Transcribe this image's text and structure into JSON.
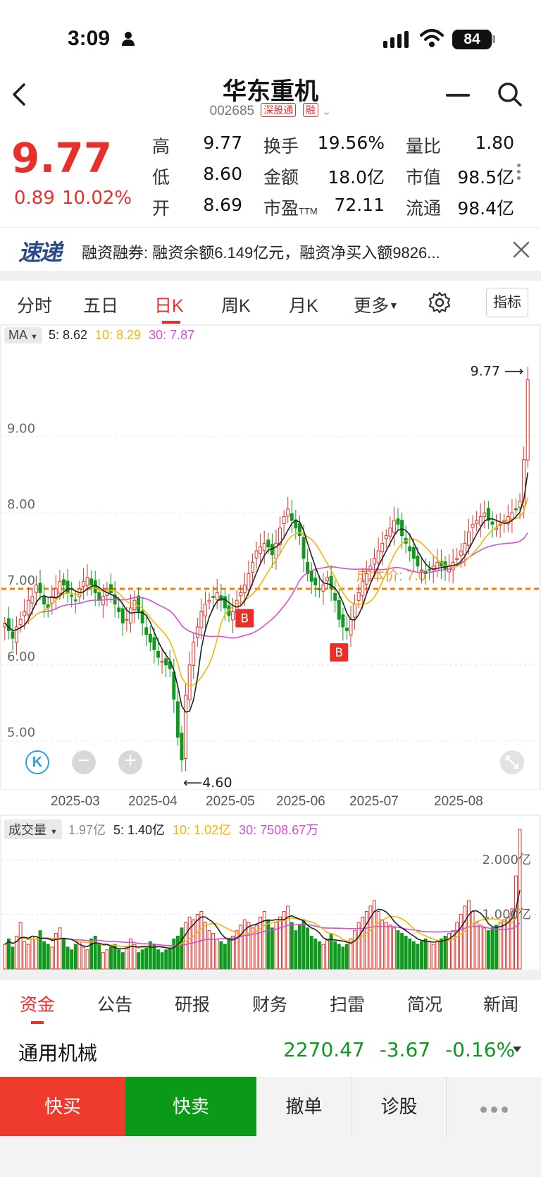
{
  "status_bar": {
    "time": "3:09",
    "battery": "84"
  },
  "header": {
    "name": "华东重机",
    "code": "002685",
    "tags": [
      "深股通",
      "融"
    ]
  },
  "quote": {
    "price": "9.77",
    "change": "0.89",
    "change_pct": "10.02%",
    "rows": [
      [
        {
          "label": "高",
          "value": "9.77",
          "color": "red"
        },
        {
          "label": "换手",
          "value": "19.56%"
        },
        {
          "label": "量比",
          "value": "1.80"
        }
      ],
      [
        {
          "label": "低",
          "value": "8.60",
          "color": "green"
        },
        {
          "label": "金额",
          "value": "18.0亿"
        },
        {
          "label": "市值",
          "value": "98.5亿"
        }
      ],
      [
        {
          "label": "开",
          "value": "8.69",
          "color": "green"
        },
        {
          "label": "市盈",
          "sub": "TTM",
          "value": "72.11"
        },
        {
          "label": "流通",
          "value": "98.4亿"
        }
      ]
    ]
  },
  "news": {
    "logo": "速递",
    "text": "融资融券: 融资余额6.149亿元，融资净买入额9826..."
  },
  "period_tabs": [
    "分时",
    "五日",
    "日K",
    "周K",
    "月K",
    "更多"
  ],
  "indicator_label": "指标",
  "ma_legend": {
    "selector": "MA",
    "ma5": "5: 8.62",
    "ma10": "10: 8.29",
    "ma30": "30: 7.87"
  },
  "chart_data": {
    "type": "candlestick",
    "x_tick_labels": [
      "2025-03",
      "2025-04",
      "2025-05",
      "2025-06",
      "2025-07",
      "2025-08"
    ],
    "y_tick_labels": [
      "9.00",
      "8.00",
      "7.00",
      "6.00",
      "5.00"
    ],
    "ylim": [
      4.45,
      10.2
    ],
    "max_label": "9.77",
    "min_label": "4.60",
    "cost_line": {
      "value": 7.0,
      "label": "成本价: 7.0",
      "color": "#ff7a00"
    },
    "buy_markers": [
      {
        "index": 61,
        "label": "B"
      },
      {
        "index": 85,
        "label": "B"
      }
    ],
    "closes": [
      6.55,
      6.45,
      6.35,
      6.5,
      6.6,
      6.7,
      6.85,
      6.9,
      7.05,
      6.95,
      6.8,
      6.75,
      6.9,
      7.0,
      7.1,
      7.05,
      6.95,
      6.9,
      6.85,
      7.0,
      7.1,
      7.15,
      7.05,
      6.95,
      6.85,
      6.9,
      7.0,
      6.95,
      6.8,
      6.7,
      6.55,
      6.6,
      6.75,
      6.85,
      6.7,
      6.55,
      6.4,
      6.3,
      6.2,
      6.1,
      6.05,
      6.0,
      5.95,
      5.55,
      5.05,
      4.75,
      5.6,
      6.0,
      6.3,
      6.5,
      6.7,
      6.8,
      6.85,
      6.9,
      6.95,
      6.85,
      6.75,
      6.65,
      6.7,
      6.85,
      6.95,
      7.05,
      7.2,
      7.35,
      7.5,
      7.55,
      7.6,
      7.55,
      7.45,
      7.6,
      7.8,
      7.95,
      8.05,
      7.9,
      7.8,
      7.7,
      7.4,
      7.2,
      7.1,
      7.05,
      7.0,
      7.05,
      7.15,
      7.0,
      6.85,
      6.6,
      6.5,
      6.45,
      6.6,
      6.8,
      6.95,
      7.1,
      7.2,
      7.3,
      7.4,
      7.5,
      7.6,
      7.7,
      7.8,
      7.9,
      7.85,
      7.7,
      7.6,
      7.5,
      7.4,
      7.3,
      7.25,
      7.2,
      7.25,
      7.3,
      7.35,
      7.3,
      7.25,
      7.3,
      7.35,
      7.4,
      7.5,
      7.6,
      7.75,
      7.85,
      7.9,
      7.95,
      8.0,
      7.9,
      7.85,
      7.8,
      7.85,
      7.9,
      7.95,
      8.0,
      8.05,
      8.15,
      8.7,
      9.75
    ]
  },
  "vol_legend": {
    "selector": "成交量",
    "total": "1.97亿",
    "ma5": "5: 1.40亿",
    "ma10": "10: 1.02亿",
    "ma30": "30: 7508.67万"
  },
  "vol_chart": {
    "y_tick_labels": [
      "2.000亿",
      "1.000亿"
    ],
    "ylim": [
      0,
      2.5
    ],
    "volumes": [
      0.45,
      0.55,
      0.4,
      0.6,
      0.85,
      0.5,
      0.45,
      0.6,
      0.55,
      0.7,
      0.5,
      0.45,
      0.4,
      0.65,
      0.75,
      0.55,
      0.4,
      0.35,
      0.45,
      0.5,
      0.4,
      0.35,
      0.55,
      0.6,
      0.45,
      0.3,
      0.35,
      0.4,
      0.45,
      0.35,
      0.3,
      0.4,
      0.55,
      0.45,
      0.3,
      0.35,
      0.4,
      0.5,
      0.45,
      0.35,
      0.3,
      0.35,
      0.4,
      0.55,
      0.6,
      0.75,
      0.85,
      0.95,
      0.9,
      1.0,
      1.05,
      0.85,
      0.7,
      0.65,
      0.55,
      0.5,
      0.45,
      0.55,
      0.6,
      0.7,
      0.8,
      0.9,
      0.85,
      0.75,
      0.8,
      0.95,
      1.05,
      0.9,
      0.75,
      0.85,
      0.95,
      1.05,
      1.15,
      0.85,
      0.7,
      0.8,
      0.9,
      0.75,
      0.6,
      0.55,
      0.5,
      0.45,
      0.55,
      0.65,
      0.5,
      0.45,
      0.4,
      0.45,
      0.55,
      0.7,
      0.85,
      0.95,
      1.05,
      1.15,
      1.25,
      1.05,
      0.9,
      0.85,
      0.8,
      0.75,
      0.7,
      0.65,
      0.6,
      0.55,
      0.5,
      0.45,
      0.5,
      0.55,
      0.5,
      0.45,
      0.5,
      0.55,
      0.6,
      0.65,
      0.7,
      0.85,
      1.0,
      1.15,
      1.25,
      1.05,
      0.85,
      0.8,
      0.75,
      0.7,
      0.75,
      0.8,
      0.85,
      0.9,
      0.95,
      1.1,
      1.7,
      2.55
    ]
  },
  "bottom_tabs": [
    "资金",
    "公告",
    "研报",
    "财务",
    "扫雷",
    "简况",
    "新闻"
  ],
  "industry": {
    "name": "通用机械",
    "value": "2270.47",
    "change": "-3.67",
    "change_pct": "-0.16%"
  },
  "actions": {
    "buy": "快买",
    "sell": "快卖",
    "cancel": "撤单",
    "diagnose": "诊股"
  },
  "colors": {
    "up": "#e8302a",
    "down": "#0e9a1d",
    "ma5": "#222222",
    "ma10": "#f2b705",
    "ma30": "#d24fd6",
    "cost": "#ff7a00"
  }
}
